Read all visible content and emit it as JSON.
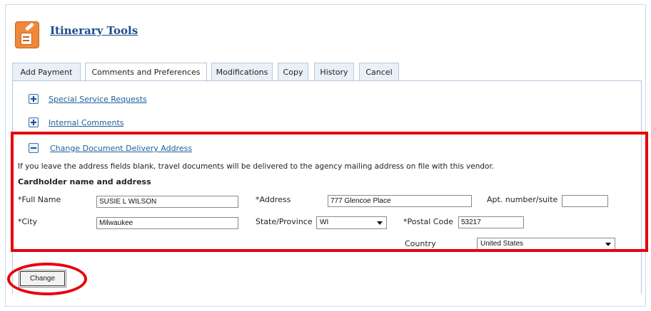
{
  "header": {
    "title": "Itinerary Tools",
    "icon": "tools-document-icon"
  },
  "tabs": [
    {
      "label": "Add Payment"
    },
    {
      "label": "Comments and Preferences",
      "active": true
    },
    {
      "label": "Modifications"
    },
    {
      "label": "Copy"
    },
    {
      "label": "History"
    },
    {
      "label": "Cancel"
    }
  ],
  "sections": [
    {
      "label": "Special Service Requests",
      "expanded": false
    },
    {
      "label": "Internal Comments",
      "expanded": false
    },
    {
      "label": "Change Document Delivery Address",
      "expanded": true
    }
  ],
  "delivery": {
    "info": "If you leave the address fields blank, travel documents will be delivered to the agency mailing address on file with this vendor.",
    "heading": "Cardholder name and address",
    "full_name_label": "*Full Name",
    "full_name_value": "SUSIE L WILSON",
    "address_label": "*Address",
    "address_value": "777 Glencoe Place",
    "apt_label": "Apt. number/suite",
    "apt_value": "",
    "city_label": "*City",
    "city_value": "Milwaukee",
    "state_label": "State/Province",
    "state_value": "WI",
    "postal_label": "*Postal Code",
    "postal_value": "53217",
    "country_label": "Country",
    "country_value": "United States"
  },
  "actions": {
    "change_label": "Change"
  },
  "colors": {
    "highlight": "#e6000d",
    "link": "#1d5f9c",
    "tab_bg": "#e9f0f7",
    "icon_orange": "#f0883a"
  }
}
